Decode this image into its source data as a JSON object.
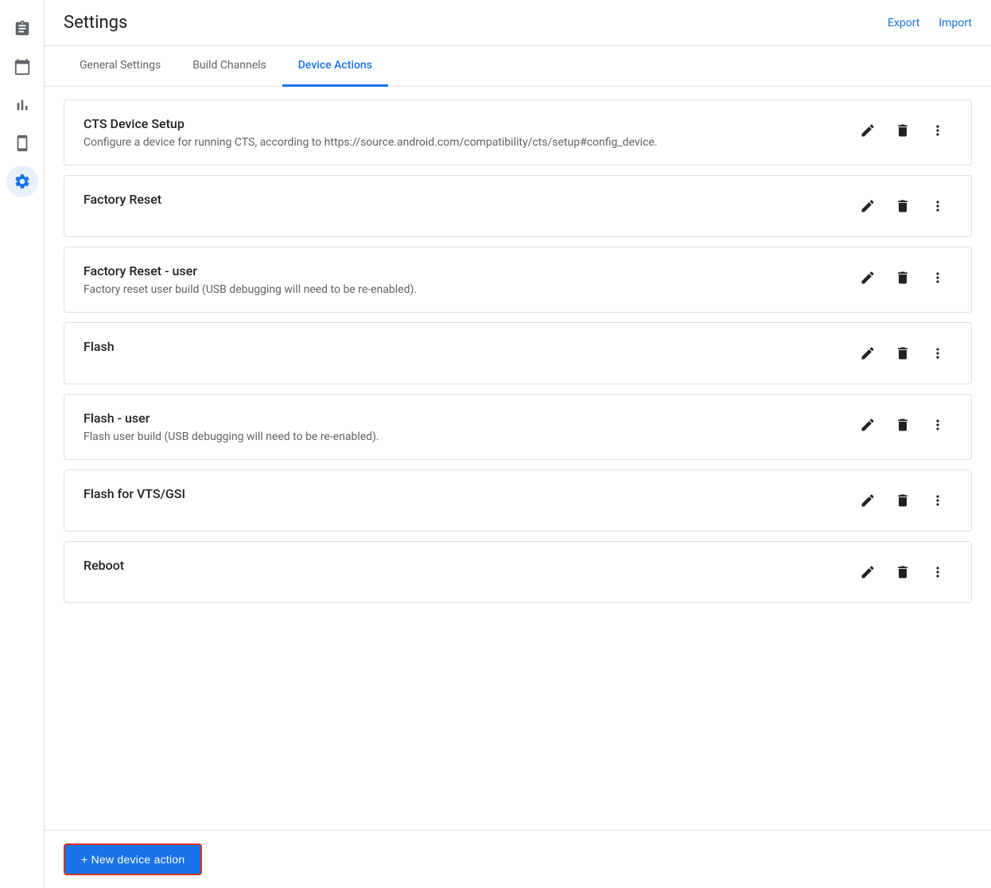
{
  "header": {
    "title": "Settings",
    "export_label": "Export",
    "import_label": "Import"
  },
  "tabs": [
    {
      "id": "general",
      "label": "General Settings",
      "active": false
    },
    {
      "id": "build-channels",
      "label": "Build Channels",
      "active": false
    },
    {
      "id": "device-actions",
      "label": "Device Actions",
      "active": true
    }
  ],
  "sidebar": {
    "items": [
      {
        "id": "clipboard",
        "icon": "clipboard",
        "active": false
      },
      {
        "id": "calendar",
        "icon": "calendar",
        "active": false
      },
      {
        "id": "chart",
        "icon": "chart",
        "active": false
      },
      {
        "id": "device",
        "icon": "device",
        "active": false
      },
      {
        "id": "settings",
        "icon": "settings",
        "active": true
      }
    ]
  },
  "device_actions": [
    {
      "id": "cts-device-setup",
      "name": "CTS Device Setup",
      "description": "Configure a device for running CTS, according to https://source.android.com/compatibility/cts/setup#config_device."
    },
    {
      "id": "factory-reset",
      "name": "Factory Reset",
      "description": ""
    },
    {
      "id": "factory-reset-user",
      "name": "Factory Reset - user",
      "description": "Factory reset user build (USB debugging will need to be re-enabled)."
    },
    {
      "id": "flash",
      "name": "Flash",
      "description": ""
    },
    {
      "id": "flash-user",
      "name": "Flash - user",
      "description": "Flash user build (USB debugging will need to be re-enabled)."
    },
    {
      "id": "flash-vts-gsi",
      "name": "Flash for VTS/GSI",
      "description": ""
    },
    {
      "id": "reboot",
      "name": "Reboot",
      "description": ""
    }
  ],
  "footer": {
    "new_action_label": "+ New device action"
  }
}
